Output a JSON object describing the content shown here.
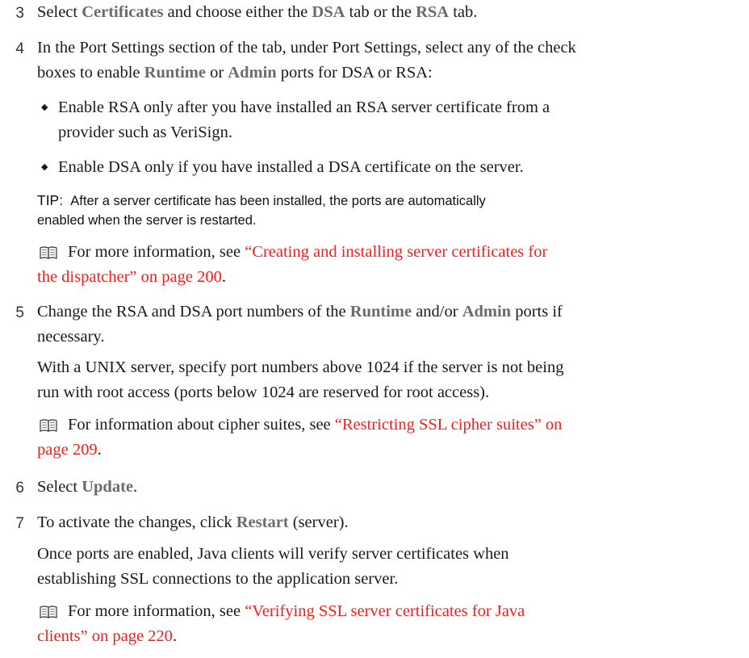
{
  "steps": {
    "s3": {
      "num": "3",
      "a": "Select ",
      "b1": "Certificates",
      "c": " and choose either the ",
      "b2": "DSA",
      "d": " tab or the ",
      "b3": "RSA",
      "e": " tab."
    },
    "s4": {
      "num": "4",
      "l1": "In the Port Settings section of the tab, under Port Settings, select any of the check",
      "l2a": "boxes to enable ",
      "b1": "Runtime",
      "l2b": " or ",
      "b2": "Admin",
      "l2c": " ports for DSA or RSA:",
      "bullets": [
        {
          "l1": "Enable RSA only after you have installed an RSA server certificate from a",
          "l2": "provider such as VeriSign."
        },
        {
          "l1": "Enable DSA only if you have installed a DSA certificate on the server."
        }
      ],
      "tip_label": "TIP:",
      "tip_l1": "After a server certificate has been installed, the ports are automatically",
      "tip_l2": "enabled when the server is restarted.",
      "ref_text": "For more information, see ",
      "ref_link_l1": "“Creating and installing server certificates for",
      "ref_link_l2": "the dispatcher” on page 200",
      "ref_end": "."
    },
    "s5": {
      "num": "5",
      "l1a": "Change the RSA and DSA port numbers of the ",
      "b1": "Runtime",
      "l1b": " and/or ",
      "b2": "Admin",
      "l1c": " ports if",
      "l2": "necessary.",
      "p_l1": "With a UNIX server, specify port numbers above 1024 if the server is not being",
      "p_l2": "run with root access (ports below 1024 are reserved for root access).",
      "ref_text": "For information about cipher suites, see ",
      "ref_link_l1": "“Restricting SSL cipher suites” on",
      "ref_link_l2": "page 209",
      "ref_end": "."
    },
    "s6": {
      "num": "6",
      "a": "Select ",
      "b1": "Update",
      "c": "."
    },
    "s7": {
      "num": "7",
      "a": "To activate the changes, click ",
      "b1": "Restart",
      "c": " (server).",
      "p_l1": "Once ports are enabled, Java clients will verify server certificates when",
      "p_l2": "establishing SSL connections to the application server.",
      "ref_text": "For more information, see ",
      "ref_link_l1": "“Verifying SSL server certificates for Java",
      "ref_link_l2": "clients” on page 220",
      "ref_end": "."
    }
  },
  "colors": {
    "link": "#ff1a1a",
    "bold_term": "#6b6b6b"
  },
  "icons": {
    "reference": "book-icon",
    "bullet": "diamond-bullet"
  }
}
